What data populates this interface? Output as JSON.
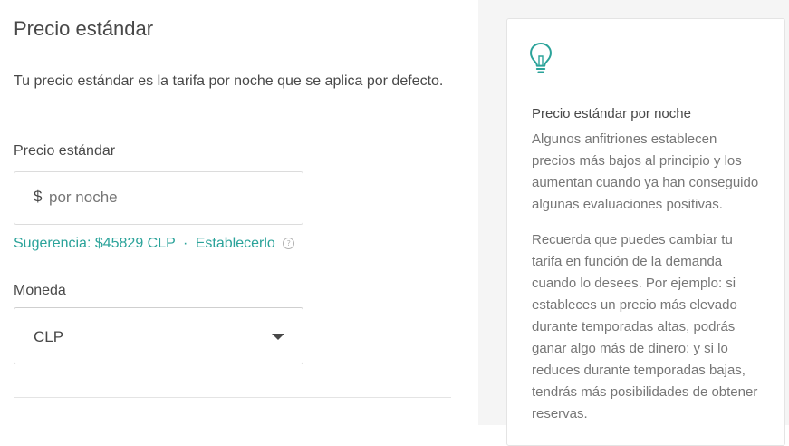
{
  "section": {
    "title": "Precio estándar",
    "description": "Tu precio estándar es la tarifa por noche que se aplica por defecto."
  },
  "price_field": {
    "label": "Precio estándar",
    "currency_symbol": "$",
    "value": "",
    "placeholder": "por noche"
  },
  "suggestion": {
    "text": "Sugerencia: $45829 CLP",
    "separator": "·",
    "action": "Establecerlo",
    "help_glyph": "?"
  },
  "currency_field": {
    "label": "Moneda",
    "selected": "CLP"
  },
  "tip_card": {
    "icon": "lightbulb-icon",
    "title": "Precio estándar por noche",
    "paragraph1": "Algunos anfitriones establecen precios más bajos al principio y los aumentan cuando ya han conseguido algunas evaluaciones positivas.",
    "paragraph2": "Recuerda que puedes cambiar tu tarifa en función de la demanda cuando lo desees. Por ejemplo: si estableces un precio más elevado durante temporadas altas, podrás ganar algo más de dinero; y si lo reduces durante temporadas bajas, tendrás más posibilidades de obtener reservas."
  },
  "colors": {
    "accent": "#2ba39a",
    "text": "#484848",
    "muted_text": "#767676",
    "sidebar_bg": "#f5f5f5",
    "border": "#dcdcdc"
  }
}
